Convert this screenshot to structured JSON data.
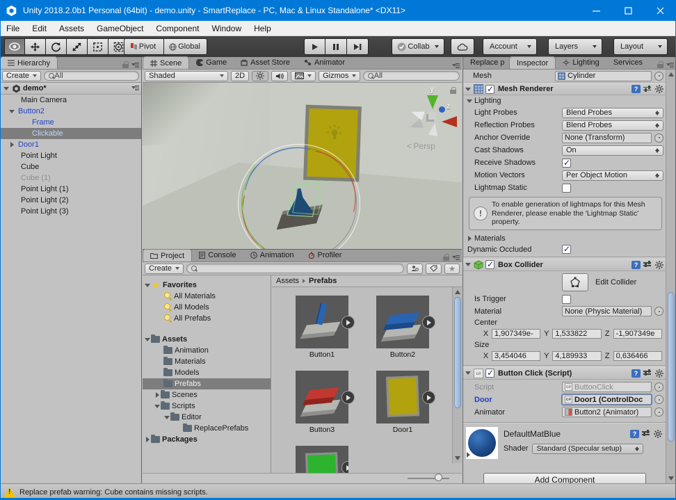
{
  "window": {
    "title": "Unity 2018.2.0b1 Personal (64bit) - demo.unity - SmartReplace - PC, Mac & Linux Standalone* <DX11>"
  },
  "menubar": [
    "File",
    "Edit",
    "Assets",
    "GameObject",
    "Component",
    "Window",
    "Help"
  ],
  "toolbar": {
    "pivot": "Pivot",
    "global": "Global",
    "collab": "Collab",
    "account": "Account",
    "layers": "Layers",
    "layout": "Layout"
  },
  "hierarchy": {
    "tab": "Hierarchy",
    "create": "Create",
    "search": "All",
    "scene_name": "demo*",
    "items": [
      {
        "label": "Main Camera"
      },
      {
        "label": "Button2"
      },
      {
        "label": "Frame"
      },
      {
        "label": "Clickable"
      },
      {
        "label": "Door1"
      },
      {
        "label": "Point Light"
      },
      {
        "label": "Cube"
      },
      {
        "label": "Cube (1)"
      },
      {
        "label": "Point Light (1)"
      },
      {
        "label": "Point Light (2)"
      },
      {
        "label": "Point Light (3)"
      }
    ]
  },
  "scene": {
    "tabs": [
      "Scene",
      "Game",
      "Asset Store",
      "Animator"
    ],
    "shaded": "Shaded",
    "btn_2d": "2D",
    "gizmos": "Gizmos",
    "search": "All",
    "persp": "Persp",
    "axes": {
      "x": "x",
      "y": "y",
      "z": "z"
    }
  },
  "project": {
    "tabs": [
      "Project",
      "Console",
      "Animation",
      "Profiler"
    ],
    "create": "Create",
    "search": "",
    "tree": [
      {
        "label": "Favorites"
      },
      {
        "label": "All Materials"
      },
      {
        "label": "All Models"
      },
      {
        "label": "All Prefabs"
      },
      {
        "label": "Assets"
      },
      {
        "label": "Animation"
      },
      {
        "label": "Materials"
      },
      {
        "label": "Models"
      },
      {
        "label": "Prefabs"
      },
      {
        "label": "Scenes"
      },
      {
        "label": "Scripts"
      },
      {
        "label": "Editor"
      },
      {
        "label": "ReplacePrefabs"
      },
      {
        "label": "Packages"
      }
    ],
    "breadcrumb": {
      "root": "Assets",
      "current": "Prefabs"
    },
    "assets": [
      {
        "name": "Button1"
      },
      {
        "name": "Button2"
      },
      {
        "name": "Button3"
      },
      {
        "name": "Door1"
      }
    ]
  },
  "inspector": {
    "tabs": [
      "Replace p",
      "Inspector",
      "Lighting",
      "Services"
    ],
    "mesh_row": {
      "label": "Mesh",
      "value": "Cylinder"
    },
    "mesh_renderer": {
      "title": "Mesh Renderer",
      "lighting_section": "Lighting",
      "light_probes": {
        "label": "Light Probes",
        "value": "Blend Probes"
      },
      "reflection_probes": {
        "label": "Reflection Probes",
        "value": "Blend Probes"
      },
      "anchor_override": {
        "label": "Anchor Override",
        "value": "None (Transform)"
      },
      "cast_shadows": {
        "label": "Cast Shadows",
        "value": "On"
      },
      "receive_shadows": {
        "label": "Receive Shadows"
      },
      "motion_vectors": {
        "label": "Motion Vectors",
        "value": "Per Object Motion"
      },
      "lightmap_static": {
        "label": "Lightmap Static"
      },
      "help_text": "To enable generation of lightmaps for this Mesh Renderer, please enable the 'Lightmap Static' property.",
      "materials": "Materials",
      "dynamic_occluded": "Dynamic Occluded"
    },
    "box_collider": {
      "title": "Box Collider",
      "edit_collider": "Edit Collider",
      "is_trigger": "Is Trigger",
      "material_label": "Material",
      "material_value": "None (Physic Material)",
      "center_label": "Center",
      "size_label": "Size",
      "axis": {
        "x": "X",
        "y": "Y",
        "z": "Z"
      },
      "center": {
        "x": "1,907349e-",
        "y": "1,533822",
        "z": "-1,907349e"
      },
      "size": {
        "x": "3,454046",
        "y": "4,189933",
        "z": "0,636466"
      }
    },
    "button_click": {
      "title": "Button Click (Script)",
      "script_label": "Script",
      "script_value": "ButtonClick",
      "door_label": "Door",
      "door_value": "Door1 (ControlDoc",
      "animator_label": "Animator",
      "animator_value": "Button2 (Animator)"
    },
    "material": {
      "name": "DefaultMatBlue",
      "shader_label": "Shader",
      "shader_value": "Standard (Specular setup)"
    },
    "add_component": "Add Component"
  },
  "statusbar": {
    "text": "Replace prefab warning: Cube contains missing scripts."
  }
}
